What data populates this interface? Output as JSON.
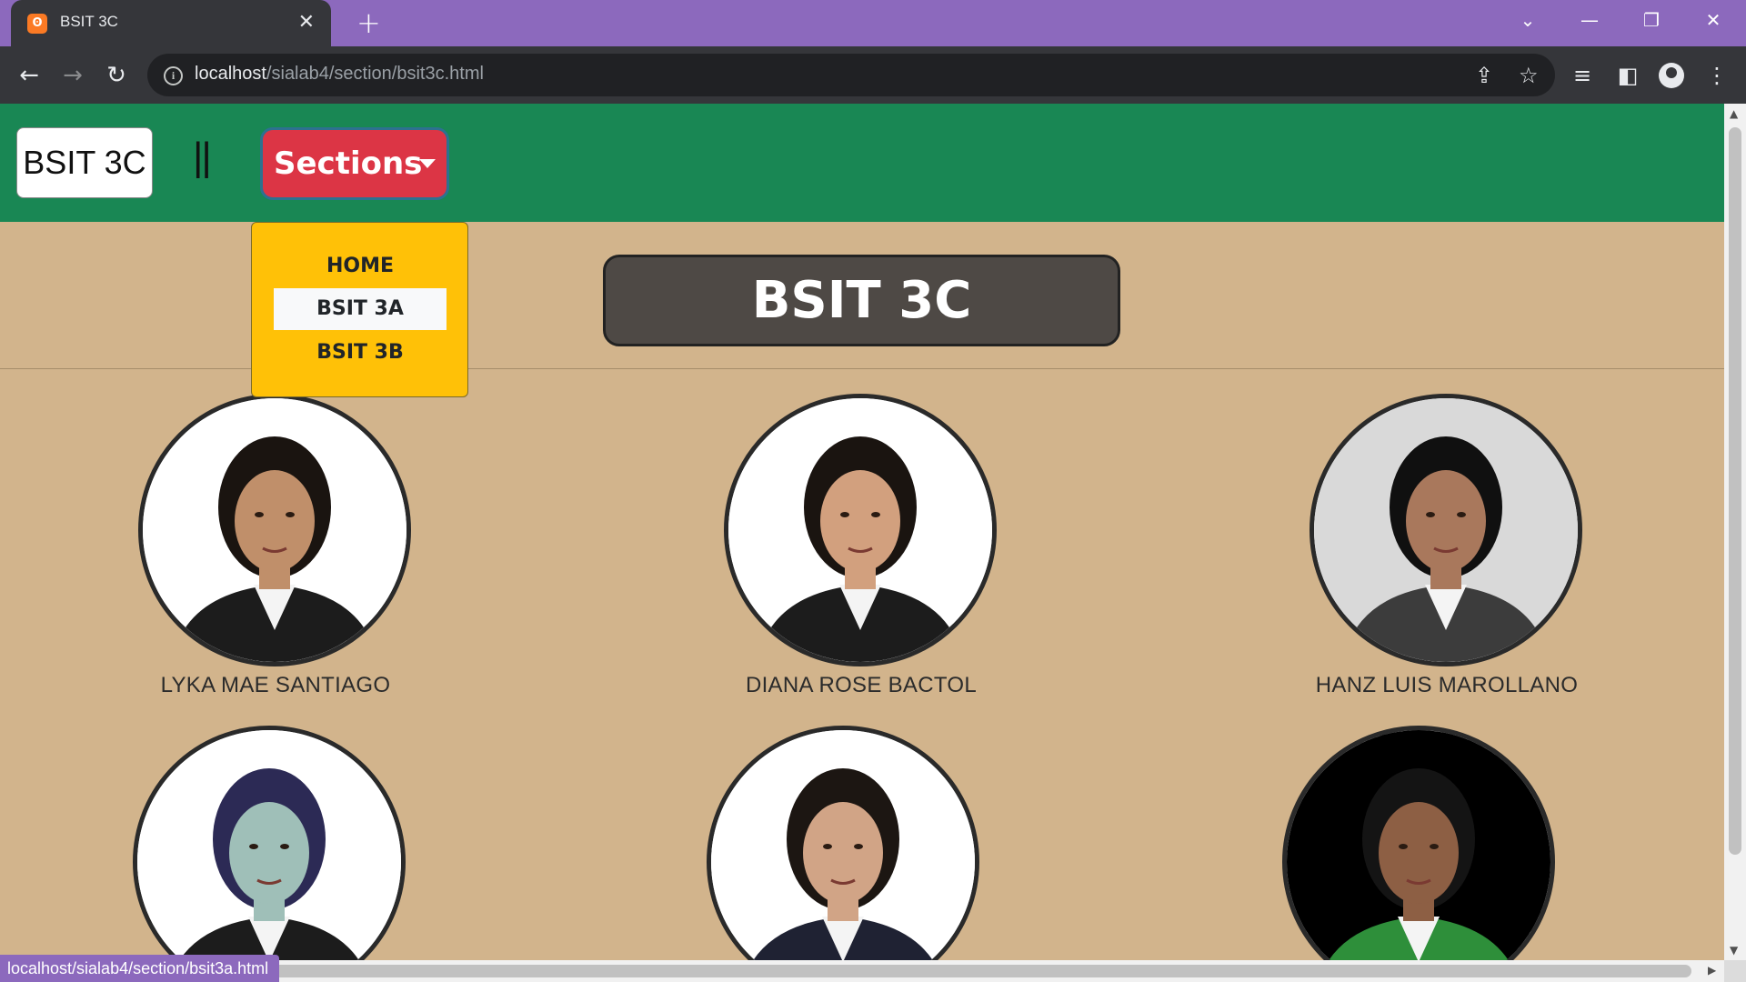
{
  "browser": {
    "tab_title": "BSIT 3C",
    "tab_favicon": "xampp-icon",
    "url_host": "localhost",
    "url_path": "/sialab4/section/bsit3c.html",
    "status_url": "localhost/sialab4/section/bsit3a.html"
  },
  "navbar": {
    "brand": "BSIT 3C",
    "separator": "||",
    "sections_label": "Sections"
  },
  "dropdown": {
    "items": [
      "HOME",
      "BSIT 3A",
      "BSIT 3B"
    ],
    "active_index": 1
  },
  "page": {
    "title": "BSIT 3C"
  },
  "students": [
    {
      "name": "LYKA MAE SANTIAGO",
      "bg": "#ffffff",
      "suit": "#1c1c1c",
      "hair": "#1a1410",
      "skin": "#c08f6a"
    },
    {
      "name": "DIANA ROSE BACTOL",
      "bg": "#ffffff",
      "suit": "#1c1c1c",
      "hair": "#1a1410",
      "skin": "#d2a07e"
    },
    {
      "name": "HANZ LUIS MAROLLANO",
      "bg": "#d9d9d9",
      "suit": "#3c3c3c",
      "hair": "#101010",
      "skin": "#a9785c"
    },
    {
      "name": "",
      "bg": "#ffffff",
      "suit": "#1c1c1c",
      "hair": "#2c2a55",
      "skin": "#9fbfb8"
    },
    {
      "name": "",
      "bg": "#ffffff",
      "suit": "#1f2233",
      "hair": "#1c1612",
      "skin": "#d1a486"
    },
    {
      "name": "",
      "bg": "#000000",
      "suit": "#2e8f3a",
      "hair": "#141414",
      "skin": "#8d5f44"
    }
  ],
  "colors": {
    "tabbar": "#8c69bd",
    "navbar": "#198754",
    "page_bg": "#d2b48c",
    "sections_button": "#dc3545",
    "dropdown_bg": "#ffc107",
    "title_box": "#4e4945"
  }
}
